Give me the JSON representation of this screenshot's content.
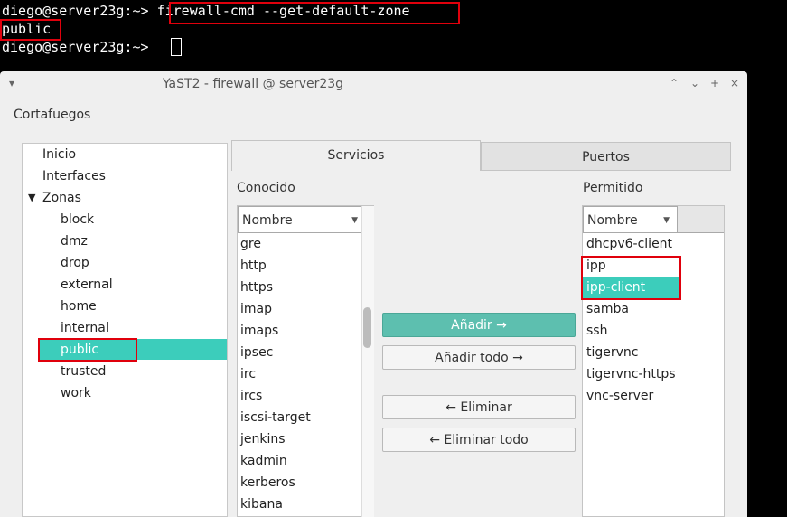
{
  "terminal": {
    "line1_prompt": "diego@server23g:~> ",
    "line1_command": "firewall-cmd --get-default-zone",
    "line2_output": "public",
    "line3_prompt": "diego@server23g:~> "
  },
  "window": {
    "title": "YaST2 - firewall @ server23g",
    "menu_glyph": "▾",
    "controls": [
      "⌃",
      "⌄",
      "+",
      "×"
    ]
  },
  "section_title": "Cortafuegos",
  "tree": {
    "items": [
      "Inicio",
      "Interfaces",
      "Zonas"
    ],
    "zones_arrow": "▼",
    "zones": [
      "block",
      "dmz",
      "drop",
      "external",
      "home",
      "internal",
      "public",
      "trusted",
      "work"
    ],
    "selected": "public"
  },
  "tabs": [
    "Servicios",
    "Puertos"
  ],
  "known": {
    "label": "Conocido",
    "column": "Nombre",
    "sort_icon": "▼",
    "items": [
      "gre",
      "http",
      "https",
      "imap",
      "imaps",
      "ipsec",
      "irc",
      "ircs",
      "iscsi-target",
      "jenkins",
      "kadmin",
      "kerberos",
      "kibana"
    ]
  },
  "allowed": {
    "label": "Permitido",
    "column": "Nombre",
    "sort_icon": "▼",
    "items": [
      "dhcpv6-client",
      "ipp",
      "ipp-client",
      "samba",
      "ssh",
      "tigervnc",
      "tigervnc-https",
      "vnc-server"
    ],
    "selected": "ipp-client"
  },
  "buttons": {
    "add": "Añadir →",
    "add_all": "Añadir todo →",
    "remove": "← Eliminar",
    "remove_all": "← Eliminar todo"
  },
  "colors": {
    "selection": "#3ccdbb",
    "highlight_box": "#e0000c"
  }
}
